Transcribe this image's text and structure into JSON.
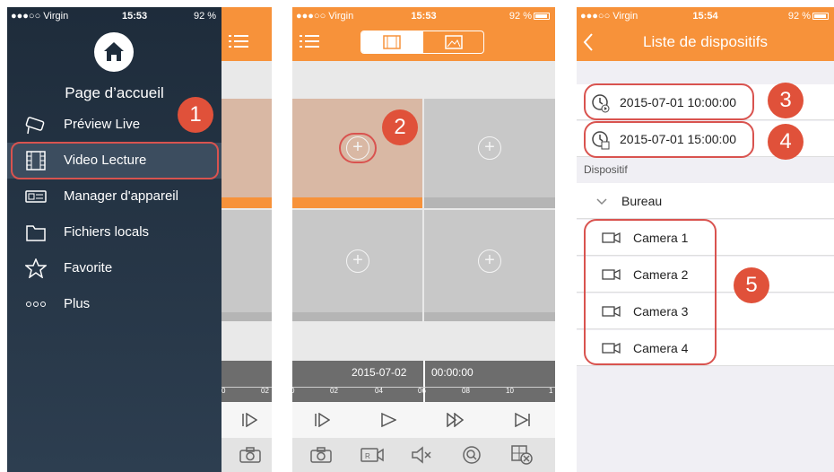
{
  "status": {
    "carrier": "●●●○○ Virgin",
    "p1_time": "15:53",
    "p2_time": "15:53",
    "p3_time": "15:54",
    "battery": "92 %"
  },
  "panel1": {
    "home_label": "Page d’accueil",
    "menu": [
      "Préview Live",
      "Video Lecture",
      "Manager d'appareil",
      "Fichiers locals",
      "Favorite",
      "Plus"
    ],
    "timeline_ticks": [
      "0",
      "02"
    ]
  },
  "panel2": {
    "timeline_date": "2015-07-02",
    "timeline_time": "00:00:00",
    "timeline_ticks": [
      "0",
      "02",
      "04",
      "06",
      "08",
      "10",
      "1"
    ]
  },
  "panel3": {
    "title": "Liste de dispositifs",
    "start_time": "2015-07-01 10:00:00",
    "end_time": "2015-07-01 15:00:00",
    "section_label": "Dispositif",
    "group_name": "Bureau",
    "cameras": [
      "Camera 1",
      "Camera 2",
      "Camera 3",
      "Camera 4"
    ]
  },
  "badges": [
    "1",
    "2",
    "3",
    "4",
    "5"
  ],
  "colors": {
    "accent": "#f7923a",
    "annotation": "#e0513a",
    "drawer": "#1e2c3b"
  }
}
